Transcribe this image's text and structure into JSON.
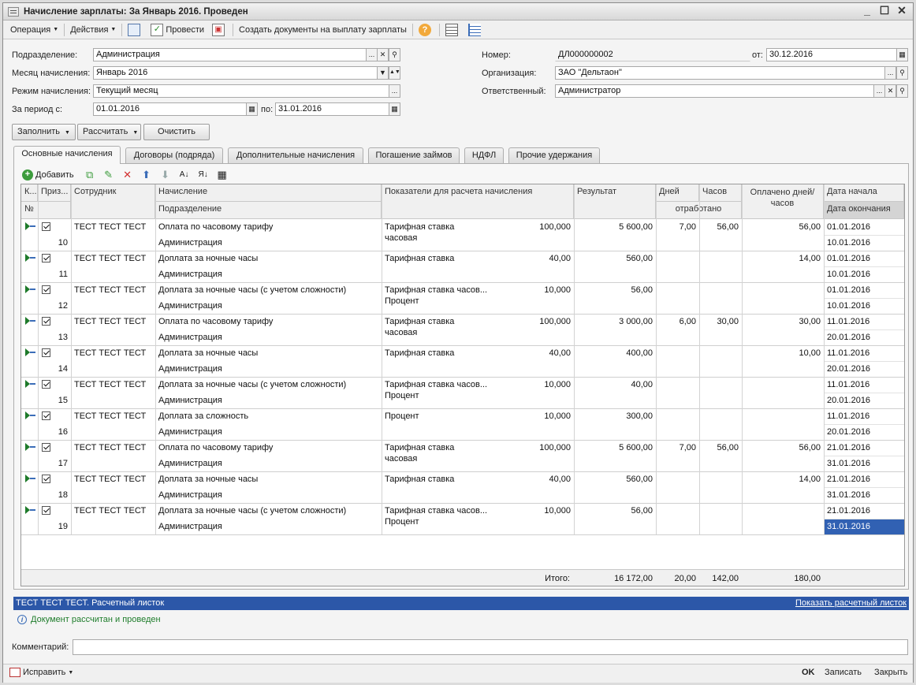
{
  "window": {
    "title": "Начисление зарплаты: За Январь 2016. Проведен"
  },
  "toolbar": {
    "operation": "Операция",
    "actions": "Действия",
    "post": "Провести",
    "create_docs": "Создать документы на выплату зарплаты",
    "help": "?"
  },
  "form": {
    "division_label": "Подразделение:",
    "division_value": "Администрация",
    "month_label": "Месяц начисления:",
    "month_value": "Январь 2016",
    "mode_label": "Режим начисления:",
    "mode_value": "Текущий месяц",
    "period_label": "За период с:",
    "period_from": "01.01.2016",
    "period_to_label": "по:",
    "period_to": "31.01.2016",
    "number_label": "Номер:",
    "number_value": "ДЛ000000002",
    "date_label": "от:",
    "date_value": "30.12.2016",
    "org_label": "Организация:",
    "org_value": "ЗАО \"Дельтаон\"",
    "resp_label": "Ответственный:",
    "resp_value": "Администратор"
  },
  "buttons": {
    "fill": "Заполнить",
    "calculate": "Рассчитать",
    "clear": "Очистить"
  },
  "tabs": [
    "Основные начисления",
    "Договоры (подряда)",
    "Дополнительные начисления",
    "Погашение займов",
    "НДФЛ",
    "Прочие удержания"
  ],
  "grid_toolbar": {
    "add": "Добавить"
  },
  "headers": {
    "k": "К...",
    "priz": "Приз...",
    "no": "№",
    "employee": "Сотрудник",
    "accrual": "Начисление",
    "division": "Подразделение",
    "indicators": "Показатели для расчета начисления",
    "result": "Результат",
    "days": "Дней",
    "hours": "Часов",
    "worked": "отработано",
    "paid": "Оплачено дней/часов",
    "date_start": "Дата начала",
    "date_end": "Дата окончания"
  },
  "rows": [
    {
      "n": "10",
      "emp": "ТЕСТ ТЕСТ ТЕСТ",
      "acc": "Оплата по часовому тарифу",
      "div": "Администрация",
      "ind1": "Тарифная ставка",
      "ind2": "часовая",
      "val": "100,000",
      "res": "5 600,00",
      "days": "7,00",
      "hours": "56,00",
      "paid": "56,00",
      "d1": "01.01.2016",
      "d2": "10.01.2016"
    },
    {
      "n": "11",
      "emp": "ТЕСТ ТЕСТ ТЕСТ",
      "acc": "Доплата за ночные часы",
      "div": "Администрация",
      "ind1": "Тарифная ставка",
      "ind2": "",
      "val": "40,00",
      "res": "560,00",
      "days": "",
      "hours": "",
      "paid": "14,00",
      "d1": "01.01.2016",
      "d2": "10.01.2016"
    },
    {
      "n": "12",
      "emp": "ТЕСТ ТЕСТ ТЕСТ",
      "acc": "Доплата за ночные часы (с учетом сложности)",
      "div": "Администрация",
      "ind1": "Тарифная ставка часов...",
      "ind2": "Процент",
      "val": "10,000",
      "res": "56,00",
      "days": "",
      "hours": "",
      "paid": "",
      "d1": "01.01.2016",
      "d2": "10.01.2016"
    },
    {
      "n": "13",
      "emp": "ТЕСТ ТЕСТ ТЕСТ",
      "acc": "Оплата по часовому тарифу",
      "div": "Администрация",
      "ind1": "Тарифная ставка",
      "ind2": "часовая",
      "val": "100,000",
      "res": "3 000,00",
      "days": "6,00",
      "hours": "30,00",
      "paid": "30,00",
      "d1": "11.01.2016",
      "d2": "20.01.2016"
    },
    {
      "n": "14",
      "emp": "ТЕСТ ТЕСТ ТЕСТ",
      "acc": "Доплата за ночные часы",
      "div": "Администрация",
      "ind1": "Тарифная ставка",
      "ind2": "",
      "val": "40,00",
      "res": "400,00",
      "days": "",
      "hours": "",
      "paid": "10,00",
      "d1": "11.01.2016",
      "d2": "20.01.2016"
    },
    {
      "n": "15",
      "emp": "ТЕСТ ТЕСТ ТЕСТ",
      "acc": "Доплата за ночные часы (с учетом сложности)",
      "div": "Администрация",
      "ind1": "Тарифная ставка часов...",
      "ind2": "Процент",
      "val": "10,000",
      "res": "40,00",
      "days": "",
      "hours": "",
      "paid": "",
      "d1": "11.01.2016",
      "d2": "20.01.2016"
    },
    {
      "n": "16",
      "emp": "ТЕСТ ТЕСТ ТЕСТ",
      "acc": "Доплата за сложность",
      "div": "Администрация",
      "ind1": "Процент",
      "ind2": "",
      "val": "10,000",
      "res": "300,00",
      "days": "",
      "hours": "",
      "paid": "",
      "d1": "11.01.2016",
      "d2": "20.01.2016"
    },
    {
      "n": "17",
      "emp": "ТЕСТ ТЕСТ ТЕСТ",
      "acc": "Оплата по часовому тарифу",
      "div": "Администрация",
      "ind1": "Тарифная ставка",
      "ind2": "часовая",
      "val": "100,000",
      "res": "5 600,00",
      "days": "7,00",
      "hours": "56,00",
      "paid": "56,00",
      "d1": "21.01.2016",
      "d2": "31.01.2016"
    },
    {
      "n": "18",
      "emp": "ТЕСТ ТЕСТ ТЕСТ",
      "acc": "Доплата за ночные часы",
      "div": "Администрация",
      "ind1": "Тарифная ставка",
      "ind2": "",
      "val": "40,00",
      "res": "560,00",
      "days": "",
      "hours": "",
      "paid": "14,00",
      "d1": "21.01.2016",
      "d2": "31.01.2016"
    },
    {
      "n": "19",
      "emp": "ТЕСТ ТЕСТ ТЕСТ",
      "acc": "Доплата за ночные часы (с учетом сложности)",
      "div": "Администрация",
      "ind1": "Тарифная ставка часов...",
      "ind2": "Процент",
      "val": "10,000",
      "res": "56,00",
      "days": "",
      "hours": "",
      "paid": "",
      "d1": "21.01.2016",
      "d2": "31.01.2016"
    }
  ],
  "totals": {
    "label": "Итого:",
    "result": "16 172,00",
    "days": "20,00",
    "hours": "142,00",
    "paid": "180,00"
  },
  "payslip": {
    "title": "ТЕСТ ТЕСТ ТЕСТ. Расчетный листок",
    "link": "Показать расчетный листок"
  },
  "status": "Документ рассчитан и проведен",
  "comment_label": "Комментарий:",
  "bottom": {
    "fix": "Исправить",
    "ok": "OK",
    "save": "Записать",
    "close": "Закрыть"
  }
}
